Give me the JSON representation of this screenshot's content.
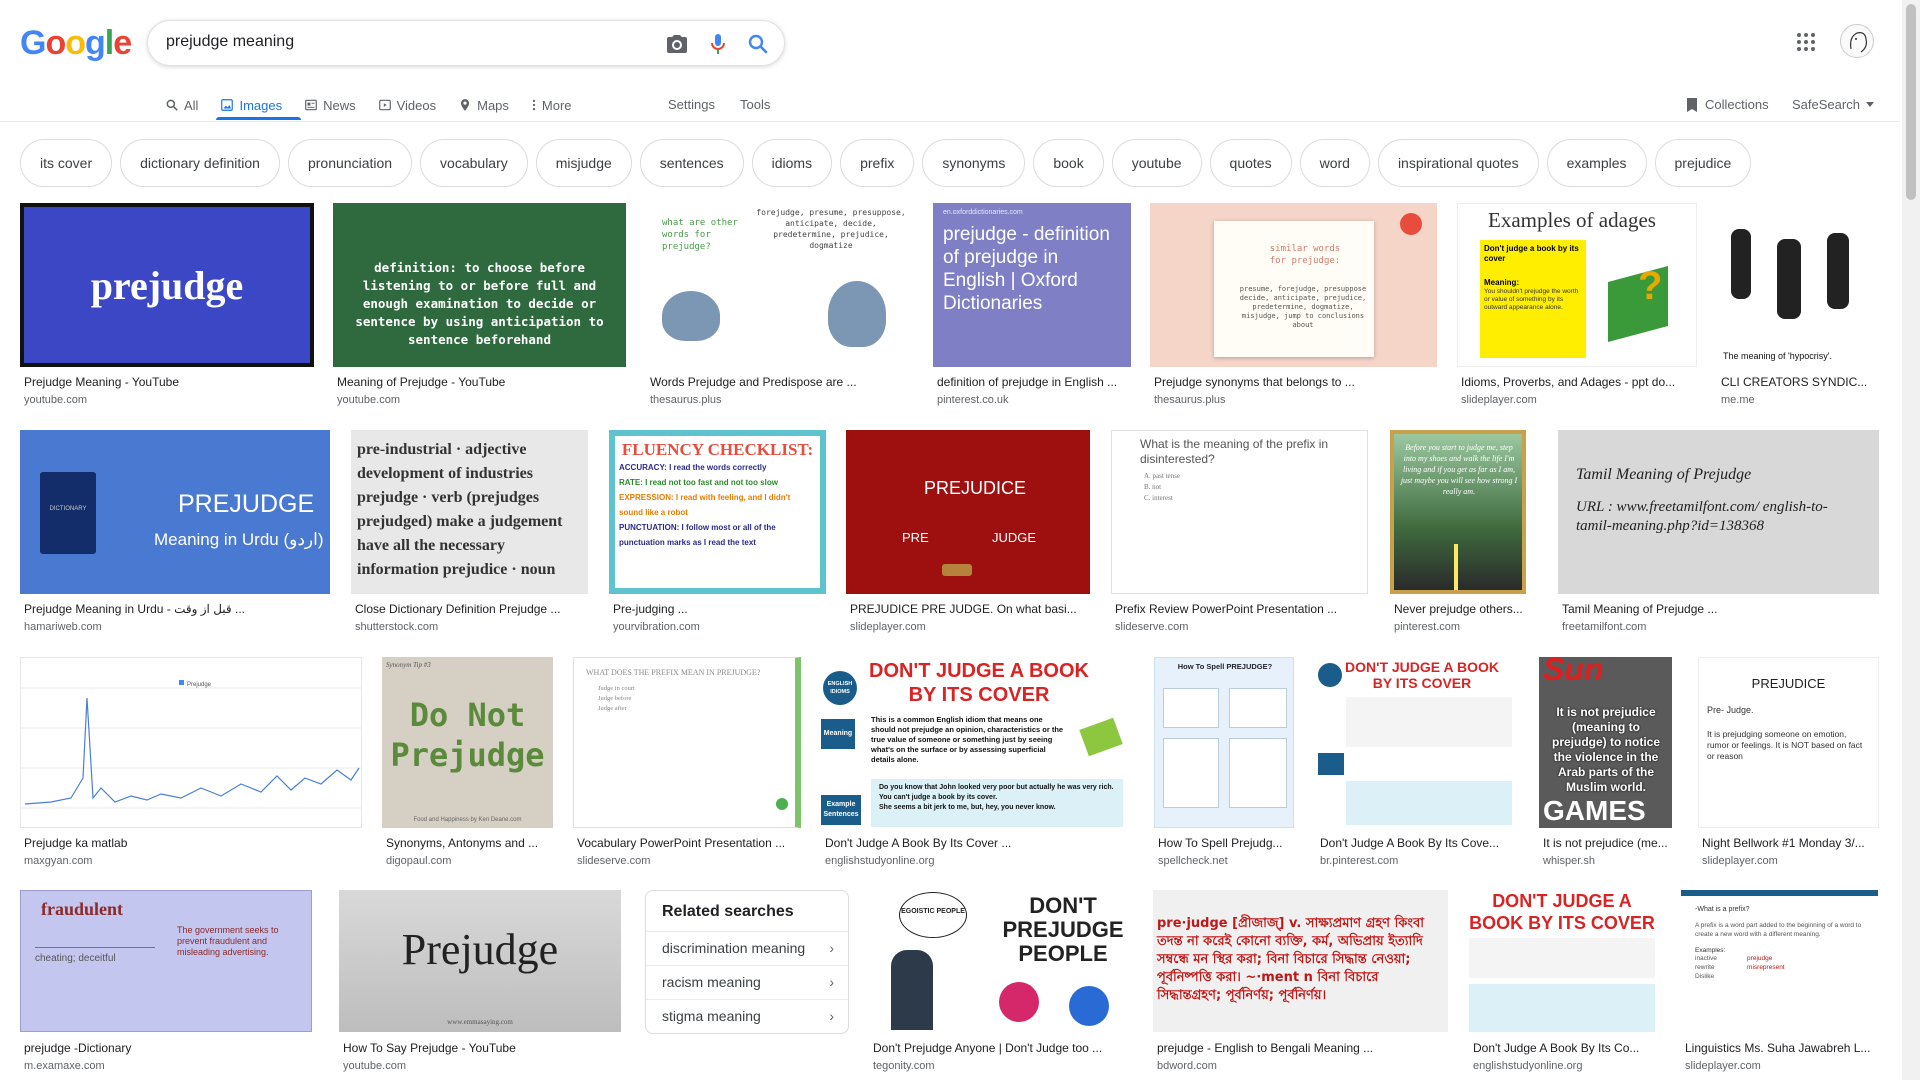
{
  "logo": {
    "letters": [
      "G",
      "o",
      "o",
      "g",
      "l",
      "e"
    ],
    "colors": [
      "#4285F4",
      "#EA4335",
      "#FBBC05",
      "#4285F4",
      "#34A853",
      "#EA4335"
    ]
  },
  "search": {
    "query": "prejudge meaning"
  },
  "icons": {
    "camera": "camera-icon",
    "mic": "mic-icon",
    "search": "search-icon",
    "apps": "apps-grid-icon"
  },
  "tabs": [
    {
      "label": "All",
      "icon": "search-icon"
    },
    {
      "label": "Images",
      "icon": "image-icon",
      "active": true
    },
    {
      "label": "News",
      "icon": "news-icon"
    },
    {
      "label": "Videos",
      "icon": "video-icon"
    },
    {
      "label": "Maps",
      "icon": "map-icon"
    },
    {
      "label": "More",
      "icon": "more-vert-icon"
    }
  ],
  "settings_label": "Settings",
  "tools_label": "Tools",
  "collections_label": "Collections",
  "safesearch_label": "SafeSearch",
  "chips": [
    "its cover",
    "dictionary definition",
    "pronunciation",
    "vocabulary",
    "misjudge",
    "sentences",
    "idioms",
    "prefix",
    "synonyms",
    "book",
    "youtube",
    "quotes",
    "word",
    "inspirational quotes",
    "examples",
    "prejudice"
  ],
  "images": [
    {
      "title": "Prejudge Meaning - YouTube",
      "source": "youtube.com",
      "text": "prejudge"
    },
    {
      "title": "Meaning of Prejudge - YouTube",
      "source": "youtube.com",
      "text": "definition: to choose before listening to or before full and enough examination to decide or sentence by using anticipation to sentence beforehand"
    },
    {
      "title": "Words Prejudge and Predispose are ...",
      "source": "thesaurus.plus",
      "text": "what are other words for prejudge?",
      "text2": "forejudge, presume, presuppose, anticipate, decide, predetermine, prejudice, dogmatize"
    },
    {
      "title": "definition of prejudge in English ...",
      "source": "pinterest.co.uk",
      "text": "prejudge - definition of prejudge in English | Oxford Dictionaries",
      "text2": "en.oxforddictionaries.com"
    },
    {
      "title": "Prejudge synonyms that belongs to ...",
      "source": "thesaurus.plus",
      "text": "similar words for prejudge:",
      "text2": "presume, forejudge, presuppose decide, anticipate, prejudice, predetermine, dogmatize, misjudge, jump to conclusions about"
    },
    {
      "title": "Idioms, Proverbs, and Adages - ppt do...",
      "source": "slideplayer.com",
      "text": "Examples of adages",
      "text2": "Don't judge a book by its cover",
      "text3": "Meaning:",
      "text4": "You shouldn't prejudge the worth or value of something by its outward appearance alone."
    },
    {
      "title": "CLI CREATORS SYNDIC...",
      "source": "me.me",
      "text": "The meaning of 'hypocrisy'."
    },
    {
      "title": "Prejudge Meaning in Urdu - قبل از وقت ...",
      "source": "hamariweb.com",
      "text": "PREJUDGE",
      "text2": "Meaning in Urdu (اردو)",
      "text3": "DICTIONARY"
    },
    {
      "title": "Close Dictionary Definition Prejudge ...",
      "source": "shutterstock.com",
      "text": "pre-industrial · adjective development of industries prejudge · verb (prejudges prejudged) make a judgement have all the necessary information prejudice · noun"
    },
    {
      "title": "Pre-judging ...",
      "source": "yourvibration.com",
      "text": "FLUENCY CHECKLIST:",
      "items": [
        "ACCURACY: I read the words correctly",
        "RATE: I read not too fast and not too slow",
        "EXPRESSION: I read with feeling, and I didn't sound like a robot",
        "PUNCTUATION: I follow most or all of the punctuation marks as I read the text"
      ]
    },
    {
      "title": "PREJUDICE PRE JUDGE. On what basi...",
      "source": "slideplayer.com",
      "text": "PREJUDICE",
      "text2": "PRE",
      "text3": "JUDGE"
    },
    {
      "title": "Prefix Review PowerPoint Presentation ...",
      "source": "slideserve.com",
      "text": "What is the meaning of the prefix in disinterested?",
      "items": [
        "A. past tense",
        "B. not",
        "C. interest"
      ]
    },
    {
      "title": "Never prejudge others...",
      "source": "pinterest.com",
      "text": "Before you start to judge me, step into my shoes and walk the life I'm living and if you get as far as I am, just maybe you will see how strong I really am."
    },
    {
      "title": "Tamil Meaning of Prejudge ...",
      "source": "freetamilfont.com",
      "text": "Tamil Meaning of Prejudge",
      "text2": "URL : www.freetamilfont.com/ english-to-tamil-meaning.php?id=138368"
    },
    {
      "title": "Prejudge ka matlab",
      "source": "maxgyan.com",
      "text": "Prejudge"
    },
    {
      "title": "Synonyms, Antonyms and ...",
      "source": "digopaul.com",
      "text": "Do Not Prejudge",
      "text2": "Synonym Tip #3",
      "text3": "Food and Happiness by Ken Deane.com"
    },
    {
      "title": "Vocabulary PowerPoint Presentation ...",
      "source": "slideserve.com",
      "text": "WHAT DOES THE PREFIX MEAN IN PREJUDGE?",
      "items": [
        "Judge in court",
        "Judge before",
        "Judge after"
      ]
    },
    {
      "title": "Don't Judge A Book By Its Cover ...",
      "source": "englishstudyonline.org",
      "text": "DON'T JUDGE A BOOK BY ITS COVER",
      "text2": "ENGLISH IDIOMS",
      "text3": "Meaning",
      "text4": "This is a common English idiom that means one should not prejudge an opinion, characteristics or the true value of someone or something just by seeing what's on the surface or by assessing superficial details alone.",
      "text5": "Example Sentences",
      "text6": "Do you know that John looked very poor but actually he was very rich. You can't judge a book by its cover.",
      "text7": "She seems a bit jerk to me, but, hey, you never know."
    },
    {
      "title": "How To Spell Prejudg...",
      "source": "spellcheck.net",
      "text": "How To Spell PREJUDGE?"
    },
    {
      "title": "Don't Judge A Book By Its Cove...",
      "source": "br.pinterest.com",
      "text": "DON'T JUDGE A BOOK BY ITS COVER"
    },
    {
      "title": "It is not prejudice (me...",
      "source": "whisper.sh",
      "text": "Sun",
      "text2": "It is not prejudice (meaning to prejudge) to notice the violence in the Arab parts of the Muslim world.",
      "text3": "GAMES"
    },
    {
      "title": "Night Bellwork #1 Monday 3/...",
      "source": "slideplayer.com",
      "text": "PREJUDICE",
      "text2": "Pre- Judge.",
      "text3": "It is prejudging someone on emotion, rumor or feelings. It is NOT based on fact or reason"
    },
    {
      "title": "prejudge -Dictionary",
      "source": "m.examaxe.com",
      "text": "fraudulent",
      "text2": "cheating; deceitful",
      "text3": "The government seeks to prevent fraudulent and misleading advertising."
    },
    {
      "title": "How To Say Prejudge - YouTube",
      "source": "youtube.com",
      "text": "Prejudge",
      "text2": "www.emmasaying.com"
    },
    {
      "title": "Don't Prejudge Anyone | Don't Judge too ...",
      "source": "tegonity.com",
      "text": "DON'T PREJUDGE PEOPLE",
      "text2": "EGOISTIC PEOPLE"
    },
    {
      "title": "prejudge - English to Bengali Meaning ...",
      "source": "bdword.com",
      "text": "pre·judge [প্রীজাজ্‌] v. সাক্ষ্যপ্রমাণ গ্রহণ কিংবা তদন্ত না করেই কোনো ব্যক্তি, কর্ম, অভিপ্রায় ইত্যাদি সম্বন্ধে মন স্থির করা; বিনা বিচারে সিদ্ধান্ত নেওয়া; পূর্বনিষ্পত্তি করা। ~·ment n বিনা বিচারে সিদ্ধান্তগ্রহণ; পূর্বনির্ণয়; পূর্বনির্ণয়।"
    },
    {
      "title": "Don't Judge A Book By Its Co...",
      "source": "englishstudyonline.org",
      "text": "DON'T JUDGE A BOOK BY ITS COVER"
    },
    {
      "title": "Linguistics Ms. Suha Jawabreh L...",
      "source": "slideplayer.com",
      "text": "-What is a prefix?",
      "text2": "A prefix is a word part added to the beginning of a word to create a new word with a different meaning.",
      "text3": "Examples:",
      "items": [
        "inactive",
        "rewrite",
        "Dislike"
      ],
      "items2": [
        "prejudge",
        "misrepresent"
      ]
    }
  ],
  "related": {
    "title": "Related searches",
    "items": [
      "discrimination meaning",
      "racism meaning",
      "stigma meaning"
    ]
  }
}
